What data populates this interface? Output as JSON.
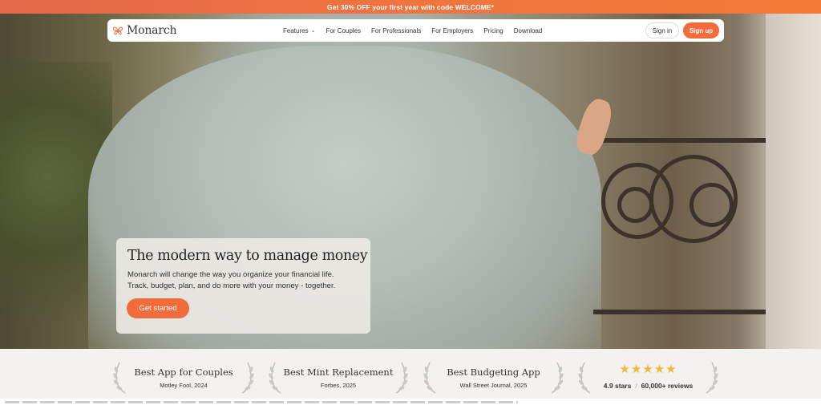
{
  "promo": {
    "text": "Get 30% OFF your first year with code WELCOME*"
  },
  "brand": {
    "name": "Monarch",
    "accent": "#f26b3a"
  },
  "nav": {
    "links": [
      {
        "label": "Features",
        "dropdown": true
      },
      {
        "label": "For Couples"
      },
      {
        "label": "For Professionals"
      },
      {
        "label": "For Employers"
      },
      {
        "label": "Pricing"
      },
      {
        "label": "Download"
      }
    ],
    "signin_label": "Sign in",
    "signup_label": "Sign up"
  },
  "hero": {
    "title": "The modern way to manage money",
    "subtitle_line1": "Monarch will change the way you organize your financial life.",
    "subtitle_line2": "Track, budget, plan, and do more with your money - together.",
    "cta_label": "Get started"
  },
  "awards": [
    {
      "title": "Best App for Couples",
      "source": "Motley Fool, 2024"
    },
    {
      "title": "Best Mint Replacement",
      "source": "Forbes, 2025"
    },
    {
      "title": "Best Budgeting App",
      "source": "Wall Street Journal, 2025"
    }
  ],
  "rating": {
    "stars": "★★★★★",
    "score": "4.9 stars",
    "separator": "/",
    "reviews": "60,000+ reviews"
  },
  "icons": {
    "logo": "butterfly-icon",
    "chevron": "chevron-down-icon",
    "laurel": "laurel-icon",
    "star": "star-icon"
  }
}
